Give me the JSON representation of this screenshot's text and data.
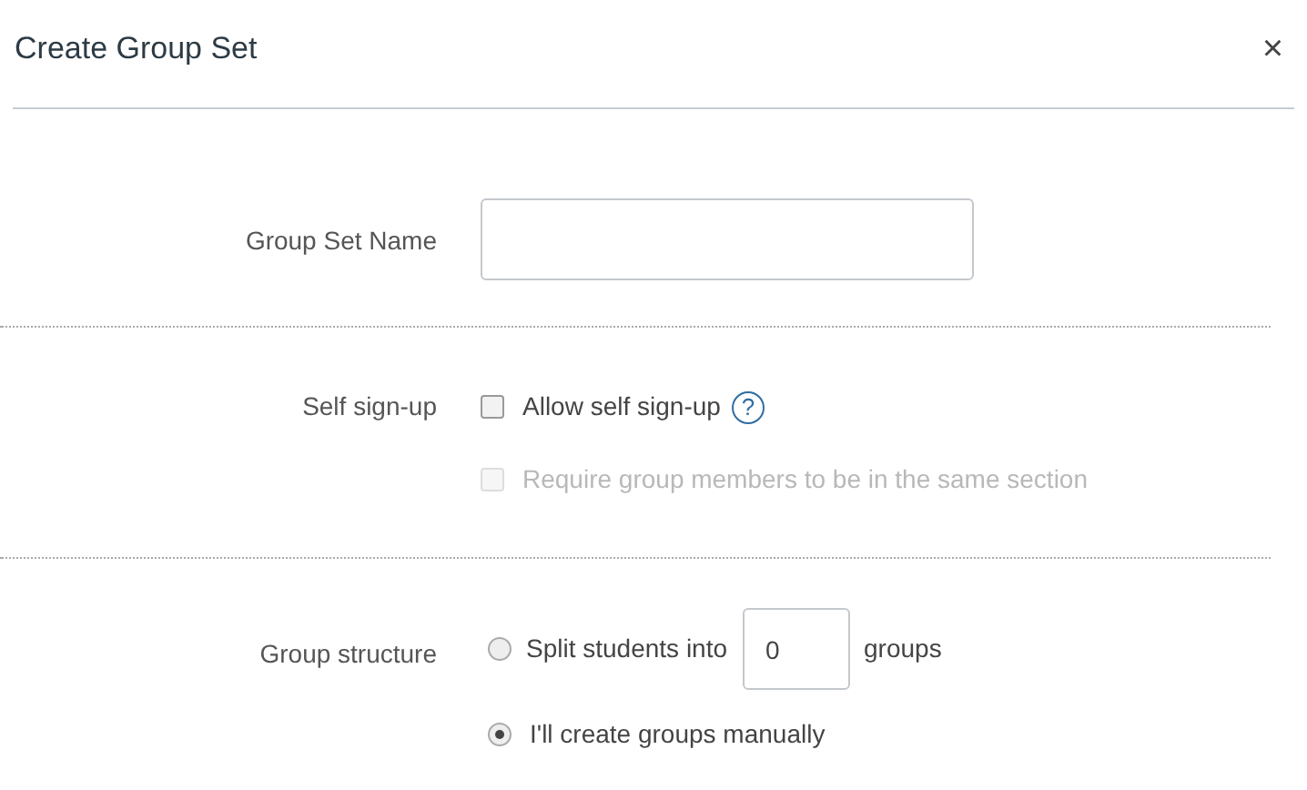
{
  "dialog": {
    "title": "Create Group Set",
    "close": "×"
  },
  "name_field": {
    "label": "Group Set Name"
  },
  "self_signup": {
    "label": "Self sign-up",
    "options": [
      {
        "label": "Allow self sign-up",
        "checked": false,
        "disabled": false,
        "help": "?"
      },
      {
        "label": "Require group members to be in the same section",
        "checked": false,
        "disabled": true
      }
    ]
  },
  "group_structure": {
    "label": "Group structure",
    "options": [
      {
        "kind": "split",
        "selected": false,
        "before": "Split students into",
        "count": "0",
        "after": "groups"
      },
      {
        "kind": "plain",
        "selected": true,
        "label": "I'll create groups manually"
      }
    ]
  }
}
